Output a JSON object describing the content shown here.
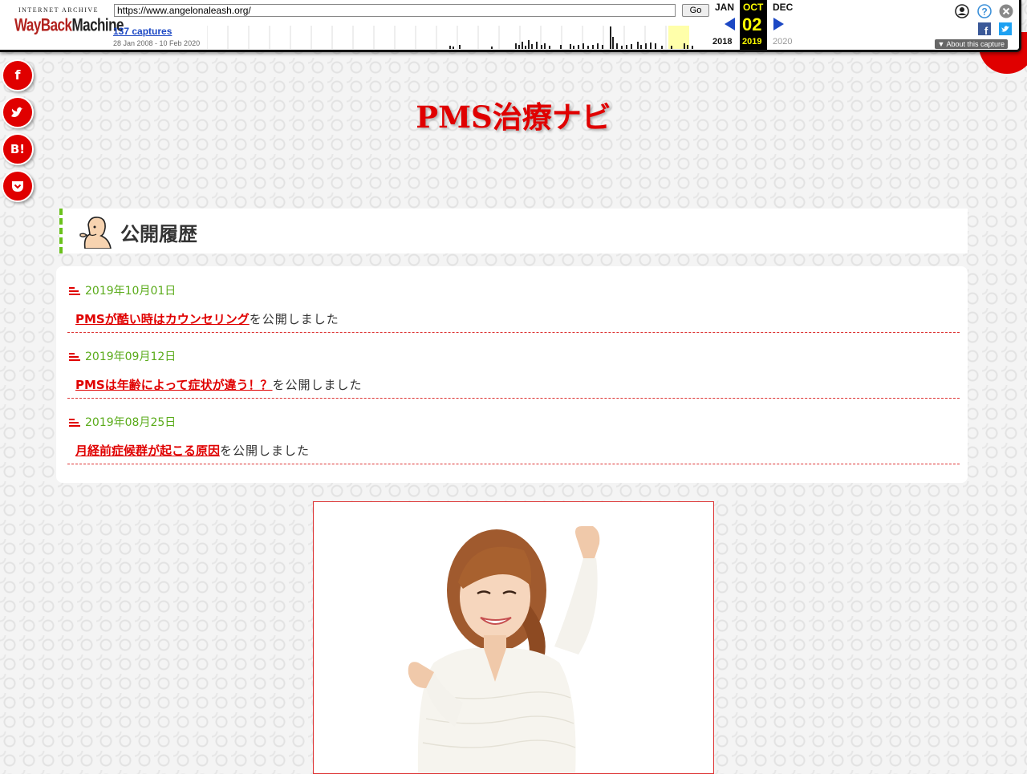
{
  "wayback": {
    "logo_top": "INTERNET ARCHIVE",
    "logo_main_a": "WayBack",
    "logo_main_b": "Machine",
    "url": "https://www.angelonaleash.org/",
    "go_label": "Go",
    "captures": "137 captures",
    "range": "28 Jan 2008 - 10 Feb 2020",
    "prev_month": "JAN",
    "cur_month": "OCT",
    "next_month": "DEC",
    "cur_day": "02",
    "prev_year": "2018",
    "cur_year": "2019",
    "next_year": "2020",
    "about": "About this capture",
    "colors": {
      "logo_red": "#b2221e",
      "link_blue": "#1c48c4",
      "current_year": "#ffff00"
    }
  },
  "share": {
    "facebook": "f",
    "hatena": "B!"
  },
  "site": {
    "title": "PMS治療ナビ",
    "accent": "#e00000"
  },
  "history": {
    "heading": "公開履歴",
    "suffix": "を公開しました",
    "entries": [
      {
        "date": "2019年10月01日",
        "title": "PMSが酷い時はカウンセリング"
      },
      {
        "date": "2019年09月12日",
        "title": "PMSは年齢によって症状が違う！？"
      },
      {
        "date": "2019年08月25日",
        "title": "月経前症候群が起こる原因"
      }
    ]
  }
}
